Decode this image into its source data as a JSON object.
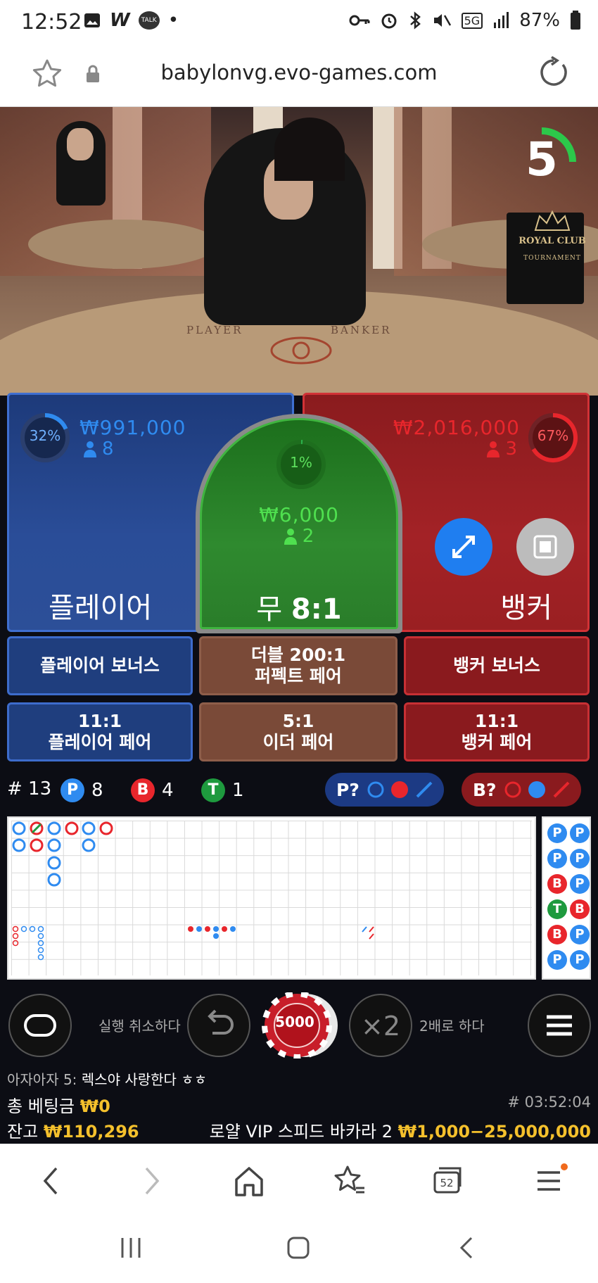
{
  "status_bar": {
    "time": "12:52",
    "app_w": "W",
    "talk": "TALK",
    "dot": "•",
    "net": "5G",
    "battery": "87%"
  },
  "browser": {
    "url": "babylonvg.evo-games.com",
    "tab_count": "52"
  },
  "video": {
    "table_label_player": "PLAYER",
    "table_label_banker": "BANKER",
    "royal_club": "ROYAL CLUB",
    "tournament": "TOURNAMENT",
    "timer": "5"
  },
  "player": {
    "percent": "32%",
    "amount": "₩991,000",
    "players": "8",
    "label": "플레이어"
  },
  "tie": {
    "percent": "1%",
    "amount": "₩6,000",
    "players": "2",
    "label": "무",
    "odds": "8:1"
  },
  "banker": {
    "percent": "67%",
    "amount": "₩2,016,000",
    "players": "3",
    "label": "뱅커"
  },
  "side_bets": {
    "row1": [
      "플레이어 보너스",
      "더블 200:1",
      "퍼펙트 페어",
      "뱅커 보너스"
    ],
    "row2": [
      "11:1",
      "플레이어 페어",
      "5:1",
      "이더 페어",
      "11:1",
      "뱅커 페어"
    ]
  },
  "stats": {
    "round": "# 13",
    "p_letter": "P",
    "p_count": "8",
    "b_letter": "B",
    "b_count": "4",
    "t_letter": "T",
    "t_count": "1",
    "ask_p": "P?",
    "ask_b": "B?"
  },
  "bead_letters": [
    "P",
    "P",
    "P",
    "P",
    "B",
    "P",
    "T",
    "B",
    "B",
    "P",
    "P",
    "P"
  ],
  "controls": {
    "undo_label": "실행 취소하다",
    "chip_value": "5000",
    "double_symbol": "×2",
    "double_label": "2배로 하다"
  },
  "info": {
    "chat_nick": "아자아자 5:",
    "chat_msg": "렉스야 사랑한다 ㅎㅎ",
    "total_label": "총 베팅금",
    "total_value": "₩0",
    "balance_label": "잔고",
    "balance_value": "₩110,296",
    "round_id": "# 03:52:04",
    "table_name": "로얄 VIP 스피드 바카라 2",
    "limits": "₩1,000−25,000,000"
  },
  "colors": {
    "player": "#2f8bf0",
    "banker": "#e8262c",
    "tie": "#2bb24c",
    "gold": "#f4c02c"
  }
}
